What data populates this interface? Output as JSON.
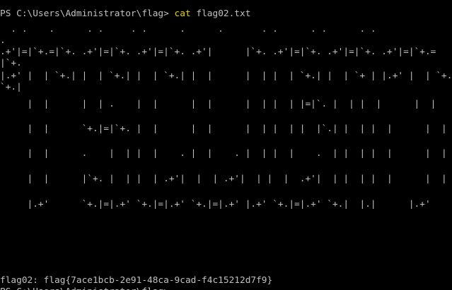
{
  "terminal": {
    "colors": {
      "background": "#000000",
      "text": "#c0c0c0",
      "command": "#e5d200"
    },
    "prompt": {
      "path": "PS C:\\Users\\Administrator\\flag> ",
      "command": "cat",
      "argument": " flag02.txt"
    },
    "art_lines": [
      "  . .    .      . .     . .      .      .       . .      . .      . .",
      ".",
      ".+'|=|`+.=|`+. .+'|=|`+. .+'|=|`+. .+'|      |`+. .+'|=|`+. .+'|=|`+. .+'|=|`+.=",
      "|`+.",
      "|.+' |  | `+.| |  | `+.| |  | `+.| |  |      |  | |  | `+.| |  | `+ | |.+' |  | `+.",
      "`+.|",
      "     |  |      |  | .    |  |      |  |      |  | |  | |=|`. |  | |  |      |  |",
      "     |  |      `+.|=|`+. |  |      |  |      |  | |  | |  |`.| |  | |  |      |  |",
      "     |  |      .    |  | |  |    . |  |    . |  | |  |    .  | |  | |  |      |  |",
      "     |  |      |`+. |  | |  | .+'|  |  | .+'|  | |  |  .+'|  | |  | |  |      |  |",
      "     |.+'      `+.|=|.+' `+.|=|.+' `+.|=|.+' |.+' `+.|=|.+' `+.|  |.|      |.+'"
    ],
    "flag_line": "flag02: flag{7ace1bcb-2e91-48ca-9cad-f4c15212d7f9}",
    "partial_line": "PS C:\\Users\\Administrator\\flag>"
  }
}
